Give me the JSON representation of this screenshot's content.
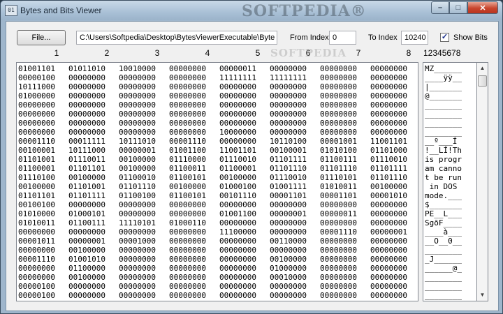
{
  "window": {
    "title": "Bytes and Bits Viewer",
    "app_icon_text": "01",
    "watermark": "SOFTPEDIA®",
    "minimize_glyph": "–",
    "maximize_glyph": "□",
    "close_glyph": "✕"
  },
  "toolbar": {
    "file_label": "File...",
    "path_value": "C:\\Users\\Softpedia\\Desktop\\BytesViewerExecutable\\Byte",
    "from_label": "From Index",
    "from_value": "0",
    "to_label": "To Index",
    "to_value": "10240",
    "show_bits_label": "Show Bits",
    "show_bits_checked": true,
    "check_glyph": "✓"
  },
  "grid": {
    "column_numbers": [
      "1",
      "2",
      "3",
      "4",
      "5",
      "6",
      "7",
      "8"
    ],
    "ascii_header": "12345678",
    "watermark": "SOFTPEDIA",
    "rows": [
      [
        "01001101",
        "01011010",
        "10010000",
        "00000000",
        "00000011",
        "00000000",
        "00000000",
        "00000000"
      ],
      [
        "00000100",
        "00000000",
        "00000000",
        "00000000",
        "11111111",
        "11111111",
        "00000000",
        "00000000"
      ],
      [
        "10111000",
        "00000000",
        "00000000",
        "00000000",
        "00000000",
        "00000000",
        "00000000",
        "00000000"
      ],
      [
        "01000000",
        "00000000",
        "00000000",
        "00000000",
        "00000000",
        "00000000",
        "00000000",
        "00000000"
      ],
      [
        "00000000",
        "00000000",
        "00000000",
        "00000000",
        "00000000",
        "00000000",
        "00000000",
        "00000000"
      ],
      [
        "00000000",
        "00000000",
        "00000000",
        "00000000",
        "00000000",
        "00000000",
        "00000000",
        "00000000"
      ],
      [
        "00000000",
        "00000000",
        "00000000",
        "00000000",
        "00000000",
        "00000000",
        "00000000",
        "00000000"
      ],
      [
        "00000000",
        "00000000",
        "00000000",
        "00000000",
        "10000000",
        "00000000",
        "00000000",
        "00000000"
      ],
      [
        "00001110",
        "00011111",
        "10111010",
        "00001110",
        "00000000",
        "10110100",
        "00001001",
        "11001101"
      ],
      [
        "00100001",
        "10111000",
        "00000001",
        "01001100",
        "11001101",
        "00100001",
        "01010100",
        "01101000"
      ],
      [
        "01101001",
        "01110011",
        "00100000",
        "01110000",
        "01110010",
        "01101111",
        "01100111",
        "01110010"
      ],
      [
        "01100001",
        "01101101",
        "00100000",
        "01100011",
        "01100001",
        "01101110",
        "01101110",
        "01101111"
      ],
      [
        "01110100",
        "00100000",
        "01100010",
        "01100101",
        "00100000",
        "01110010",
        "01110101",
        "01101110"
      ],
      [
        "00100000",
        "01101001",
        "01101110",
        "00100000",
        "01000100",
        "01001111",
        "01010011",
        "00100000"
      ],
      [
        "01101101",
        "01101111",
        "01100100",
        "01100101",
        "00101110",
        "00001101",
        "00001101",
        "00001010"
      ],
      [
        "00100100",
        "00000000",
        "00000000",
        "00000000",
        "00000000",
        "00000000",
        "00000000",
        "00000000"
      ],
      [
        "01010000",
        "01000101",
        "00000000",
        "00000000",
        "01001100",
        "00000001",
        "00000011",
        "00000000"
      ],
      [
        "01010011",
        "01100111",
        "11110101",
        "01000110",
        "00000000",
        "00000000",
        "00000000",
        "00000000"
      ],
      [
        "00000000",
        "00000000",
        "00000000",
        "00000000",
        "11100000",
        "00000000",
        "00001110",
        "00000001"
      ],
      [
        "00001011",
        "00000001",
        "00001000",
        "00000000",
        "00000000",
        "00110000",
        "00000000",
        "00000000"
      ],
      [
        "00000000",
        "00100000",
        "00000000",
        "00000000",
        "00000000",
        "00000000",
        "00000000",
        "00000000"
      ],
      [
        "00001110",
        "01001010",
        "00000000",
        "00000000",
        "00000000",
        "00100000",
        "00000000",
        "00000000"
      ],
      [
        "00000000",
        "01100000",
        "00000000",
        "00000000",
        "00000000",
        "01000000",
        "00000000",
        "00000000"
      ],
      [
        "00000000",
        "00100000",
        "00000000",
        "00000000",
        "00000000",
        "00010000",
        "00000000",
        "00000000"
      ],
      [
        "00000100",
        "00000000",
        "00000000",
        "00000000",
        "00000000",
        "00000000",
        "00000000",
        "00000000"
      ],
      [
        "00000100",
        "00000000",
        "00000000",
        "00000000",
        "00000000",
        "00000000",
        "00000000",
        "00000000"
      ]
    ],
    "ascii_rows": [
      "MZ______",
      "____ÿÿ__",
      "|_______",
      "@_______",
      "________",
      "________",
      "________",
      "________",
      "__º___Í",
      "!__LÍ!Th",
      "is progr",
      "am canno",
      "t be run",
      " in DOS ",
      "mode.___",
      "$_______",
      "PE__L___",
      "SgõF____",
      "____à___",
      "__O__0__",
      "________",
      "_J______",
      "______@_",
      "________",
      "________",
      "________"
    ]
  },
  "scrollbar": {
    "up_glyph": "▲",
    "down_glyph": "▼"
  }
}
